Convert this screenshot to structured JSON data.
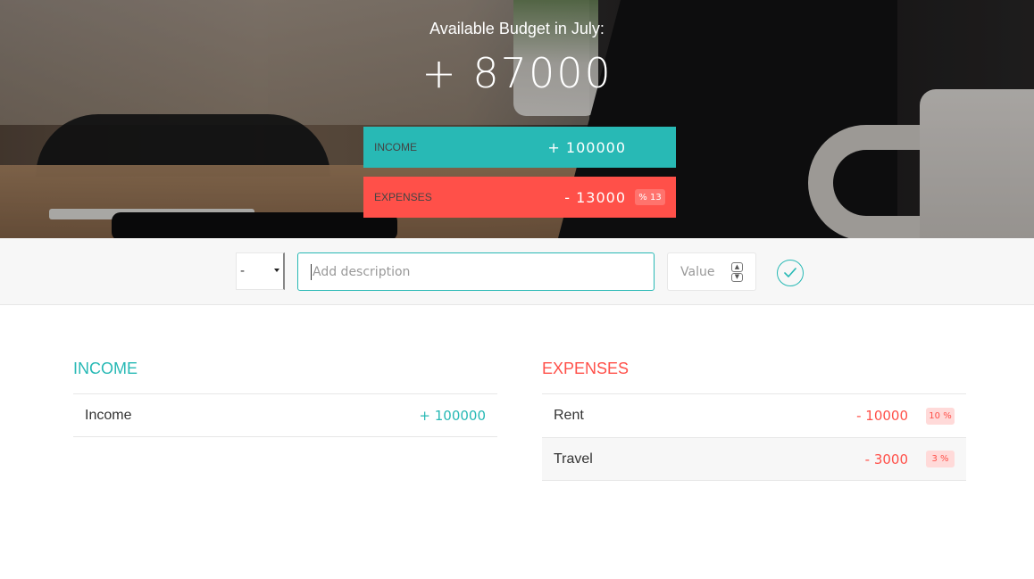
{
  "budget": {
    "title": "Available Budget in July:",
    "value": "+ 87000",
    "income_label": "Income",
    "income_value": "+ 100000",
    "expenses_label": "Expenses",
    "expenses_value": "- 13000",
    "expenses_percentage": "% 13"
  },
  "add_form": {
    "type_selected": "-",
    "description_placeholder": "Add description",
    "value_placeholder": "Value",
    "submit_icon": "check-circle-icon"
  },
  "income_list": {
    "title": "Income",
    "items": [
      {
        "description": "Income",
        "value": "+ 100000"
      }
    ]
  },
  "expenses_list": {
    "title": "Expenses",
    "items": [
      {
        "description": "Rent",
        "value": "- 10000",
        "percentage": "10 %"
      },
      {
        "description": "Travel",
        "value": "- 3000",
        "percentage": "3 %"
      }
    ]
  },
  "colors": {
    "income": "#28b9b5",
    "expenses": "#ff5049",
    "bar_background": "#f7f7f7"
  }
}
